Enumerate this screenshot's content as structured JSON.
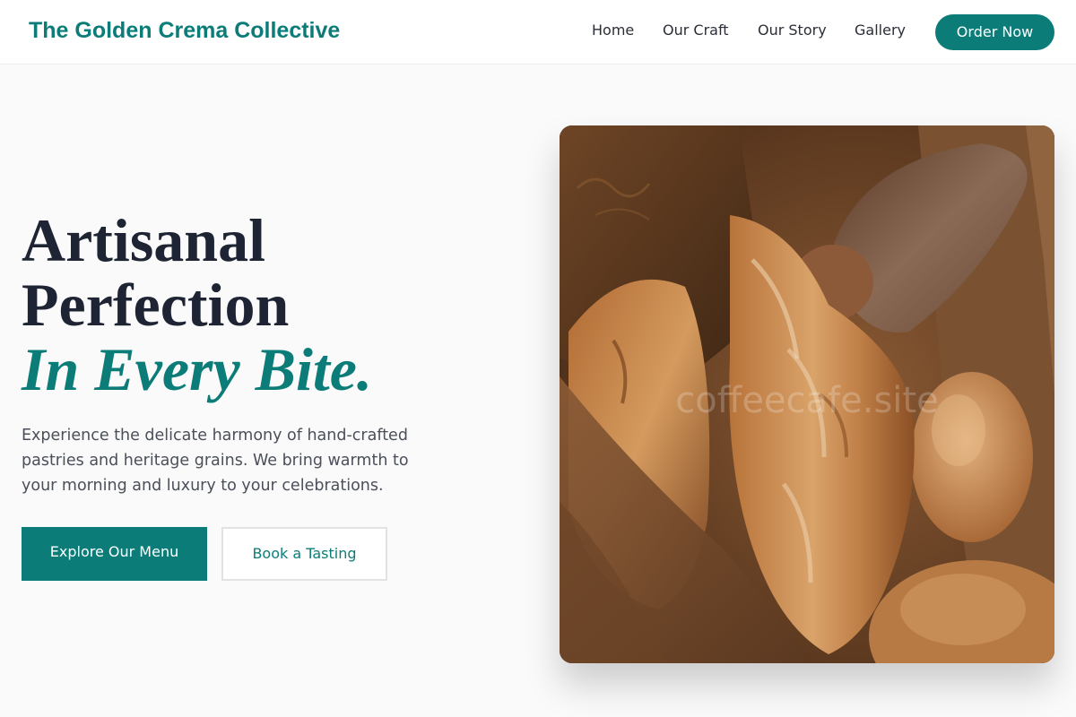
{
  "header": {
    "brand": "The Golden Crema Collective",
    "nav": [
      {
        "label": "Home"
      },
      {
        "label": "Our Craft"
      },
      {
        "label": "Our Story"
      },
      {
        "label": "Gallery"
      }
    ],
    "cta_label": "Order Now"
  },
  "hero": {
    "title_line1": "Artisanal",
    "title_line2": "Perfection",
    "title_accent": "In Every Bite.",
    "description": "Experience the delicate harmony of hand-crafted pastries and heritage grains. We bring warmth to your morning and luxury to your celebrations.",
    "primary_button": "Explore Our Menu",
    "secondary_button": "Book a Tasting",
    "image": {
      "subject": "artisan breads in a paper bag",
      "watermark": "coffeecafe.site"
    }
  },
  "colors": {
    "accent": "#0c7c78",
    "text_dark": "#1e2433",
    "text_muted": "#4a4f5a",
    "background": "#fafafa"
  }
}
